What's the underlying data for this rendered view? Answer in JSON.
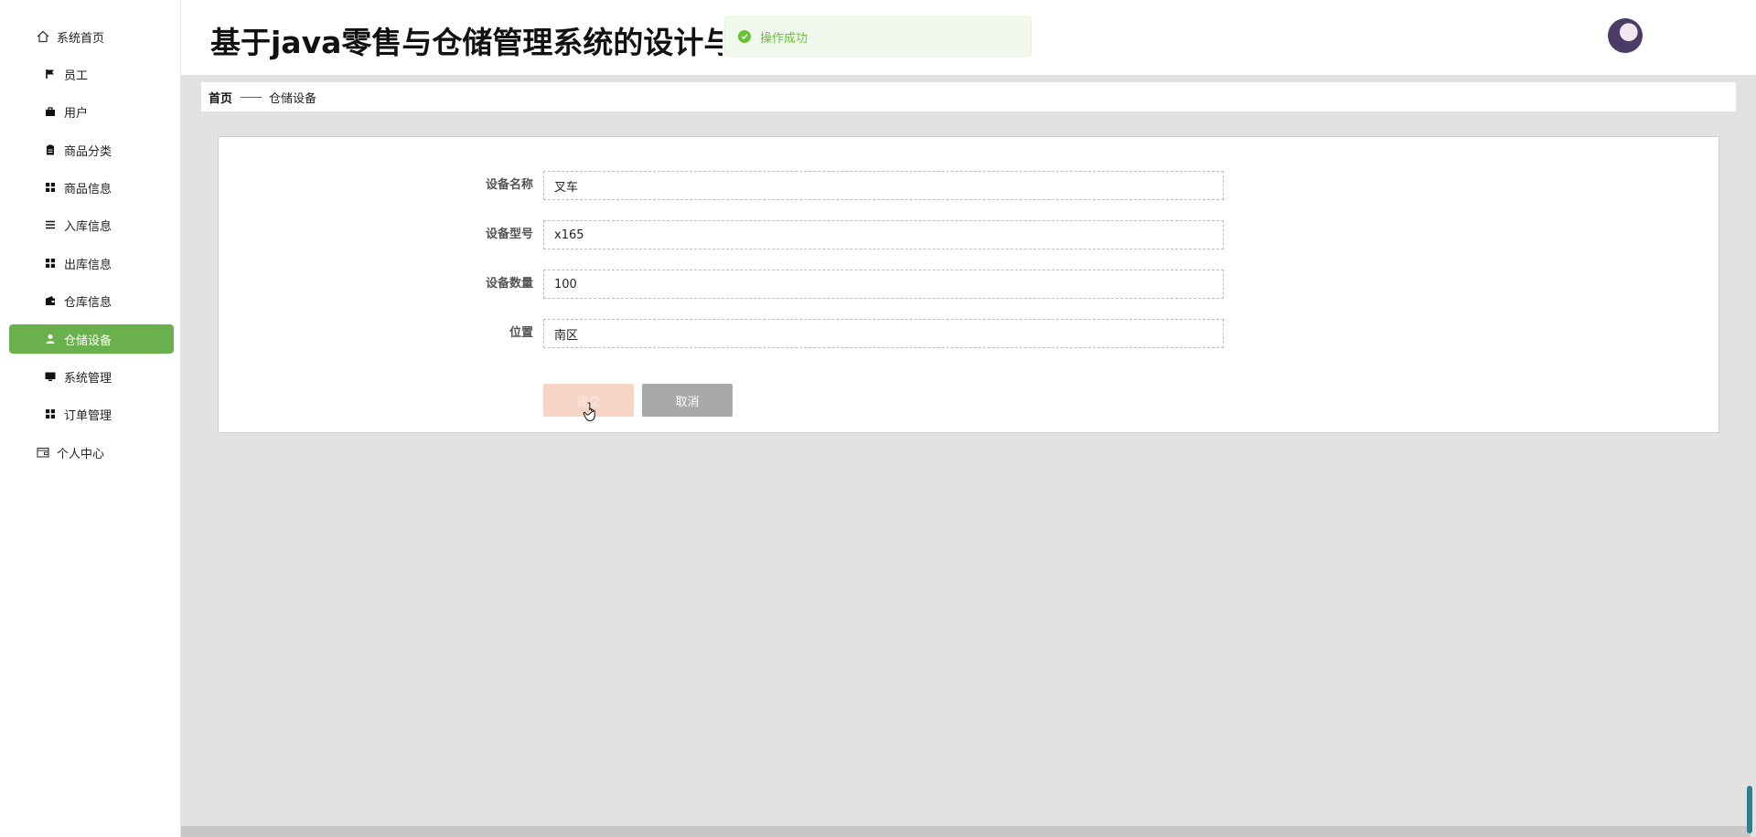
{
  "app": {
    "title": "基于java零售与仓储管理系统的设计与实"
  },
  "toast": {
    "message": "操作成功",
    "icon": "check-circle-icon",
    "color": "#67c23a"
  },
  "sidebar": {
    "active_color": "#6ab04c",
    "items": [
      {
        "label": "系统首页",
        "icon": "home-icon"
      },
      {
        "label": "员工",
        "icon": "flag-icon"
      },
      {
        "label": "用户",
        "icon": "briefcase-icon"
      },
      {
        "label": "商品分类",
        "icon": "clipboard-icon"
      },
      {
        "label": "商品信息",
        "icon": "grid-icon"
      },
      {
        "label": "入库信息",
        "icon": "list-icon"
      },
      {
        "label": "出库信息",
        "icon": "grid-icon"
      },
      {
        "label": "仓库信息",
        "icon": "wallet-icon"
      },
      {
        "label": "仓储设备",
        "icon": "user-icon"
      },
      {
        "label": "系统管理",
        "icon": "monitor-icon"
      },
      {
        "label": "订单管理",
        "icon": "grid-icon"
      },
      {
        "label": "个人中心",
        "icon": "wallet-outline-icon"
      }
    ]
  },
  "breadcrumb": {
    "home": "首页",
    "separator": "——",
    "current": "仓储设备"
  },
  "form": {
    "fields": [
      {
        "label": "设备名称",
        "value": "叉车"
      },
      {
        "label": "设备型号",
        "value": "x165"
      },
      {
        "label": "设备数量",
        "value": "100"
      },
      {
        "label": "位置",
        "value": "南区"
      }
    ],
    "submit_label": "提交",
    "cancel_label": "取消"
  }
}
